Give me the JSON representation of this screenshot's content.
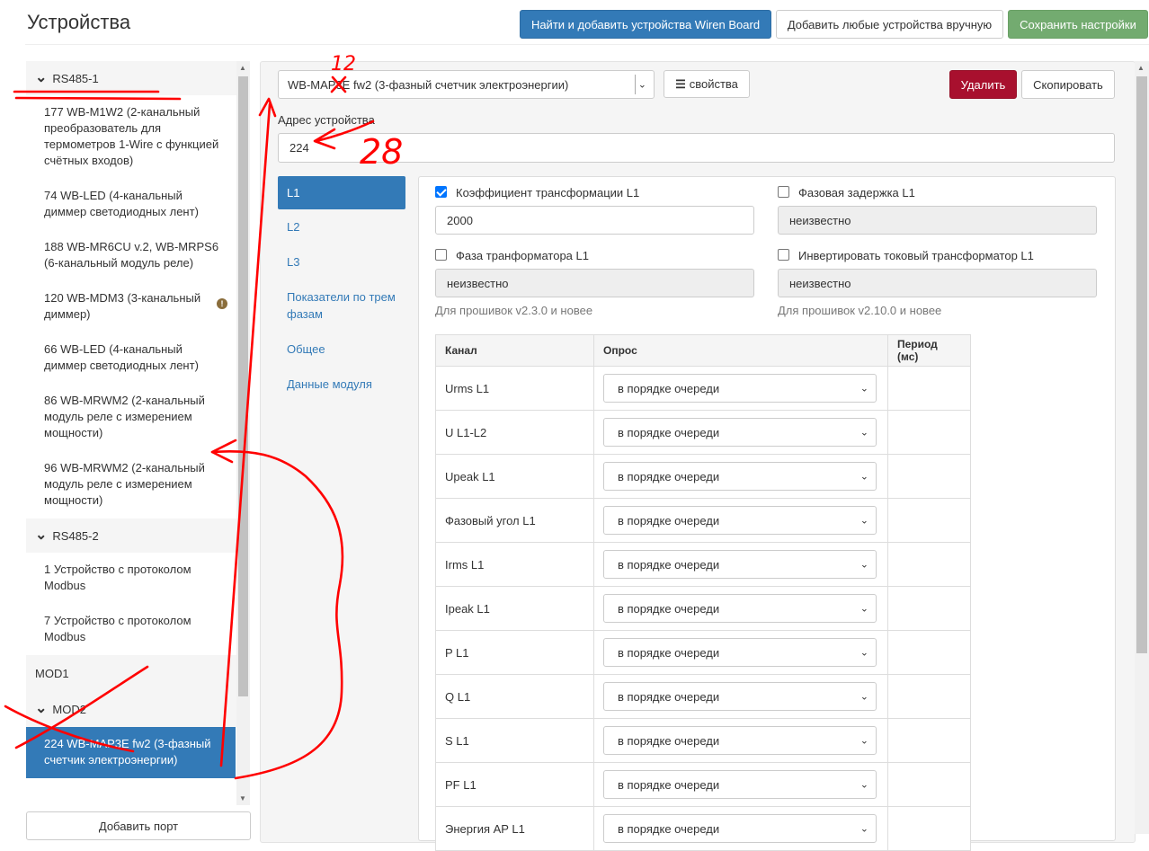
{
  "header": {
    "title": "Устройства",
    "btn_find": "Найти и добавить устройства Wiren Board",
    "btn_add_manual": "Добавить любые устройства вручную",
    "btn_save": "Сохранить настройки"
  },
  "sidebar": {
    "ports": [
      {
        "name": "RS485-1",
        "expanded": true,
        "devices": [
          "177 WB-M1W2 (2-канальный преобразователь для термометров 1-Wire с функцией счётных входов)",
          "74 WB-LED (4-канальный диммер светодиодных лент)",
          "188 WB-MR6CU v.2, WB-MRPS6 (6-канальный модуль реле)",
          "120 WB-MDM3 (3-канальный диммер)",
          "66 WB-LED (4-канальный диммер светодиодных лент)",
          "86 WB-MRWM2 (2-канальный модуль реле с измерением мощности)",
          "96 WB-MRWM2 (2-канальный модуль реле с измерением мощности)"
        ]
      },
      {
        "name": "RS485-2",
        "expanded": true,
        "devices": [
          "1 Устройство с протоколом Modbus",
          "7 Устройство с протоколом Modbus"
        ]
      },
      {
        "name": "MOD1",
        "expanded": false,
        "devices": []
      },
      {
        "name": "MOD2",
        "expanded": true,
        "devices": [
          "224 WB-MAP3E fw2 (3-фазный счетчик электроэнергии)"
        ]
      }
    ],
    "add_port": "Добавить порт"
  },
  "device": {
    "type_selected": "WB-MAP3E fw2 (3-фазный счетчик электроэнергии)",
    "btn_properties": "свойства",
    "btn_delete": "Удалить",
    "btn_copy": "Скопировать",
    "address_label": "Адрес устройства",
    "address_value": "224"
  },
  "tabs": [
    "L1",
    "L2",
    "L3",
    "Показатели по трем фазам",
    "Общее",
    "Данные модуля"
  ],
  "params": {
    "ct_ratio": {
      "label": "Коэффициент трансформации L1",
      "checked": true,
      "value": "2000"
    },
    "phase_delay": {
      "label": "Фазовая задержка L1",
      "checked": false,
      "value": "неизвестно"
    },
    "transformer_phase": {
      "label": "Фаза транформатора L1",
      "checked": false,
      "value": "неизвестно",
      "help": "Для прошивок v2.3.0 и новее"
    },
    "invert_ct": {
      "label": "Инвертировать токовый трансформатор L1",
      "checked": false,
      "value": "неизвестно",
      "help": "Для прошивок v2.10.0 и новее"
    }
  },
  "channels": {
    "headers": [
      "Канал",
      "Опрос",
      "Период (мс)"
    ],
    "rows": [
      {
        "name": "Urms L1",
        "poll": "в порядке очереди"
      },
      {
        "name": "U L1-L2",
        "poll": "в порядке очереди"
      },
      {
        "name": "Upeak L1",
        "poll": "в порядке очереди"
      },
      {
        "name": "Фазовый угол L1",
        "poll": "в порядке очереди"
      },
      {
        "name": "Irms L1",
        "poll": "в порядке очереди"
      },
      {
        "name": "Ipeak L1",
        "poll": "в порядке очереди"
      },
      {
        "name": "P L1",
        "poll": "в порядке очереди"
      },
      {
        "name": "Q L1",
        "poll": "в порядке очереди"
      },
      {
        "name": "S L1",
        "poll": "в порядке очереди"
      },
      {
        "name": "PF L1",
        "poll": "в порядке очереди"
      },
      {
        "name": "Энергия AP L1",
        "poll": "в порядке очереди"
      }
    ]
  },
  "annotations": {
    "num_12": "12",
    "num_28": "28"
  },
  "colors": {
    "primary": "#337ab7",
    "success": "#73ab70",
    "danger": "#a8102e",
    "annotation": "#ff0000"
  }
}
